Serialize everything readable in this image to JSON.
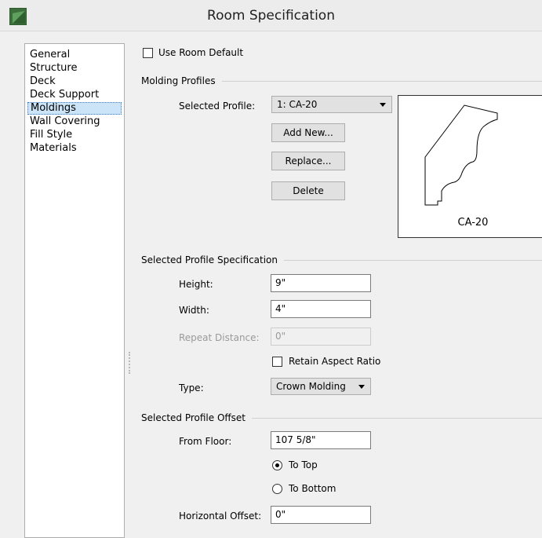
{
  "window": {
    "title": "Room Specification"
  },
  "sidebar": {
    "items": [
      {
        "label": "General"
      },
      {
        "label": "Structure"
      },
      {
        "label": "Deck"
      },
      {
        "label": "Deck Support"
      },
      {
        "label": "Moldings",
        "selected": true
      },
      {
        "label": "Wall Covering"
      },
      {
        "label": "Fill Style"
      },
      {
        "label": "Materials"
      }
    ]
  },
  "use_room_default": {
    "label": "Use Room Default",
    "checked": false
  },
  "molding_profiles": {
    "group_label": "Molding Profiles",
    "selected_profile_label": "Selected Profile:",
    "selected_profile_value": "1:  CA-20",
    "add_new_label": "Add New...",
    "replace_label": "Replace...",
    "delete_label": "Delete",
    "preview_name": "CA-20"
  },
  "profile_spec": {
    "group_label": "Selected Profile Specification",
    "height_label": "Height:",
    "height_value": "9\"",
    "width_label": "Width:",
    "width_value": "4\"",
    "repeat_label": "Repeat Distance:",
    "repeat_value": "0\"",
    "retain_aspect_label": "Retain Aspect Ratio",
    "retain_aspect_checked": false,
    "type_label": "Type:",
    "type_value": "Crown Molding"
  },
  "profile_offset": {
    "group_label": "Selected Profile Offset",
    "from_floor_label": "From Floor:",
    "from_floor_value": "107 5/8\"",
    "to_top_label": "To Top",
    "to_top_selected": true,
    "to_bottom_label": "To Bottom",
    "to_bottom_selected": false,
    "horizontal_offset_label": "Horizontal Offset:",
    "horizontal_offset_value": "0\""
  },
  "colors": {
    "selection_bg": "#cce4f7",
    "selection_border": "#3a7bd5",
    "button_bg": "#e1e1e1",
    "window_bg": "#f0f0f0"
  }
}
